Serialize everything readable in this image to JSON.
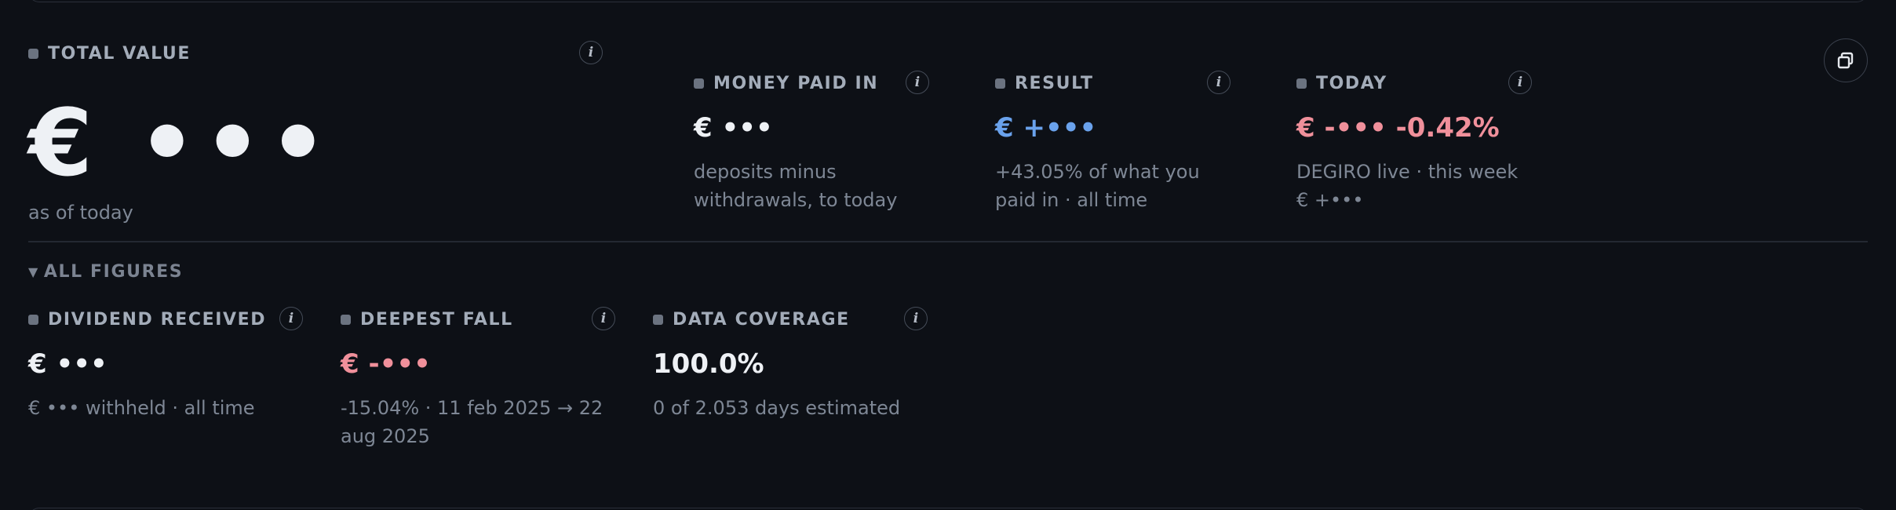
{
  "total_value": {
    "label": "TOTAL VALUE",
    "value": "€ •••",
    "sub": "as of today"
  },
  "metrics": {
    "money_paid_in": {
      "label": "MONEY PAID IN",
      "value": "€ •••",
      "sub": "deposits minus withdrawals, to today"
    },
    "result": {
      "label": "RESULT",
      "value": "€ +•••",
      "sub": "+43.05% of what you paid in · all time"
    },
    "today": {
      "label": "TODAY",
      "value": "€ -••• -0.42%",
      "sub": "DEGIRO live · this week € +•••"
    }
  },
  "section": {
    "toggle_label": "ALL FIGURES",
    "caret": "▼"
  },
  "figures": {
    "dividend_received": {
      "label": "DIVIDEND RECEIVED",
      "value": "€ •••",
      "sub": "€ ••• withheld · all time"
    },
    "deepest_fall": {
      "label": "DEEPEST FALL",
      "value": "€ -•••",
      "sub": "-15.04% · 11 feb 2025 → 22 aug 2025"
    },
    "data_coverage": {
      "label": "DATA COVERAGE",
      "value": "100.0%",
      "sub": "0 of 2.053 days estimated"
    }
  },
  "icons": {
    "info": "i",
    "copy": "copy-icon"
  },
  "colors": {
    "background": "#0d1016",
    "positive": "#6aa2ec",
    "negative": "#f0909b",
    "text": "#eef1f5",
    "muted": "#7e8795"
  }
}
